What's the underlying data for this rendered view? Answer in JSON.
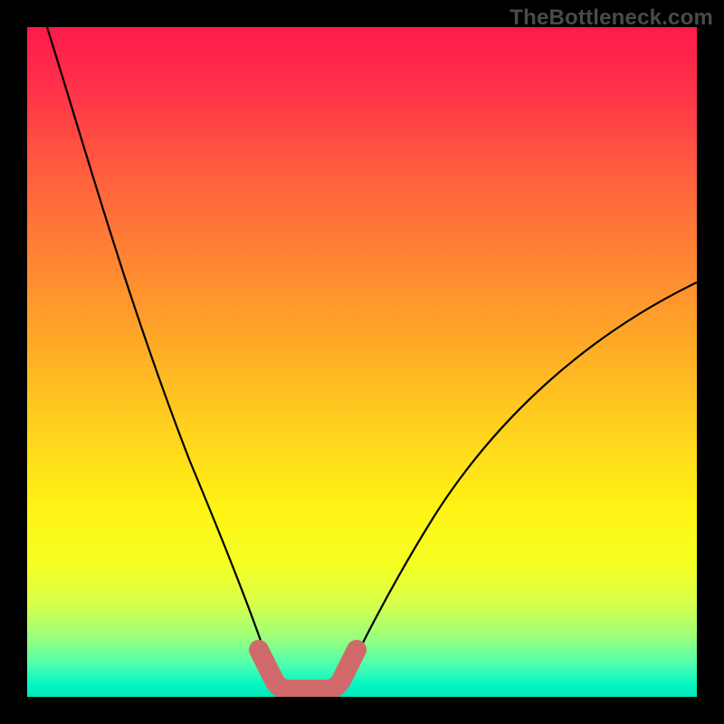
{
  "watermark": "TheBottleneck.com",
  "chart_data": {
    "type": "line",
    "title": "",
    "xlabel": "",
    "ylabel": "",
    "xlim": [
      0,
      100
    ],
    "ylim": [
      0,
      100
    ],
    "grid": false,
    "legend": false,
    "series": [
      {
        "name": "left-curve",
        "x": [
          3,
          5,
          8,
          12,
          16,
          20,
          24,
          28,
          31,
          34,
          36,
          37
        ],
        "y": [
          100,
          90,
          78,
          64,
          51,
          39,
          28,
          18,
          11,
          6,
          3,
          1
        ]
      },
      {
        "name": "right-curve",
        "x": [
          46,
          48,
          51,
          55,
          60,
          66,
          73,
          80,
          88,
          95,
          100
        ],
        "y": [
          1,
          4,
          8,
          14,
          21,
          29,
          37,
          45,
          52,
          58,
          62
        ]
      },
      {
        "name": "valley-highlight",
        "x": [
          35,
          36,
          37,
          38,
          40,
          42,
          44,
          46,
          47,
          48,
          49
        ],
        "y": [
          6,
          3,
          1.5,
          1,
          1,
          1,
          1,
          1.5,
          3,
          5,
          7
        ]
      }
    ],
    "colors": {
      "curve": "#000000",
      "highlight": "#d96a6a",
      "background_top": "#ff1a4b",
      "background_mid": "#fff314",
      "background_bottom": "#00e6b8"
    }
  }
}
